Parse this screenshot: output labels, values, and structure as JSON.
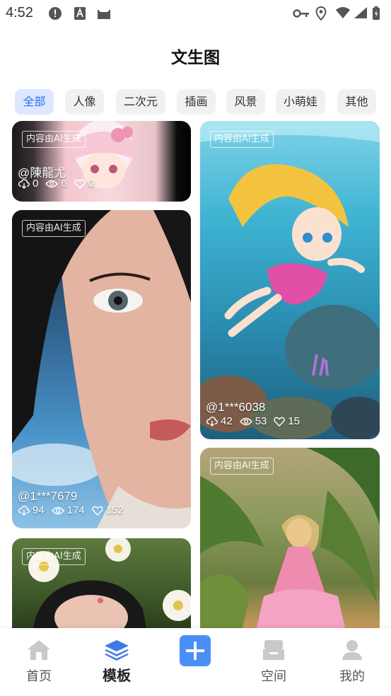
{
  "status": {
    "time": "4:52"
  },
  "header": {
    "title": "文生图"
  },
  "tabs": [
    {
      "label": "全部",
      "active": true
    },
    {
      "label": "人像"
    },
    {
      "label": "二次元"
    },
    {
      "label": "插画"
    },
    {
      "label": "风景"
    },
    {
      "label": "小萌娃"
    },
    {
      "label": "其他"
    }
  ],
  "badge": "内容由AI生成",
  "cards": [
    {
      "author": "@陳龍尤",
      "downloads": "0",
      "views": "6",
      "likes": "0"
    },
    {
      "author": "@1***7679",
      "downloads": "94",
      "views": "174",
      "likes": "152"
    },
    {
      "author": "",
      "downloads": "",
      "views": "",
      "likes": ""
    },
    {
      "author": "@1***6038",
      "downloads": "42",
      "views": "53",
      "likes": "15"
    },
    {
      "author": "",
      "downloads": "",
      "views": "",
      "likes": ""
    }
  ],
  "nav": [
    {
      "label": "首页",
      "icon": "home-icon"
    },
    {
      "label": "模板",
      "icon": "layers-icon",
      "active": true
    },
    {
      "label": "",
      "icon": "plus-icon"
    },
    {
      "label": "空间",
      "icon": "drawer-icon"
    },
    {
      "label": "我的",
      "icon": "user-icon"
    }
  ],
  "colors": {
    "accent": "#2f6fe8",
    "tab_active_bg": "#dbe8ff",
    "add_button": "#4a8ff6"
  }
}
